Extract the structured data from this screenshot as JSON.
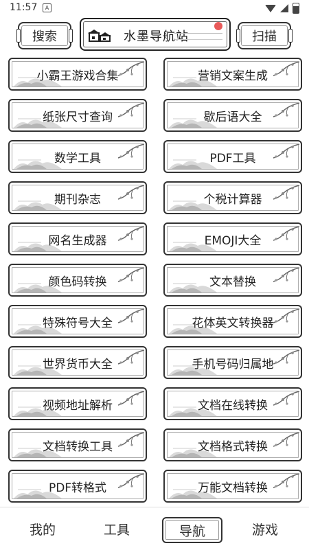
{
  "status_bar": {
    "time": "11:57",
    "sim_label": "A"
  },
  "header": {
    "search_label": "搜索",
    "title": "水墨导航站",
    "scan_label": "扫描"
  },
  "tools": [
    "小霸王游戏合集",
    "营销文案生成",
    "纸张尺寸查询",
    "歇后语大全",
    "数学工具",
    "PDF工具",
    "期刊杂志",
    "个税计算器",
    "网名生成器",
    "EMOJI大全",
    "颜色码转换",
    "文本替换",
    "特殊符号大全",
    "花体英文转换器",
    "世界货币大全",
    "手机号码归属地",
    "视频地址解析",
    "文档在线转换",
    "文档转换工具",
    "文档格式转换",
    "PDF转格式",
    "万能文档转换"
  ],
  "tabs": [
    {
      "label": "我的"
    },
    {
      "label": "工具"
    },
    {
      "label": "导航"
    },
    {
      "label": "游戏"
    }
  ],
  "active_tab": "导航",
  "colors": {
    "ink": "#333333",
    "accent_sun": "#e85a5a",
    "background": "#ffffff"
  }
}
